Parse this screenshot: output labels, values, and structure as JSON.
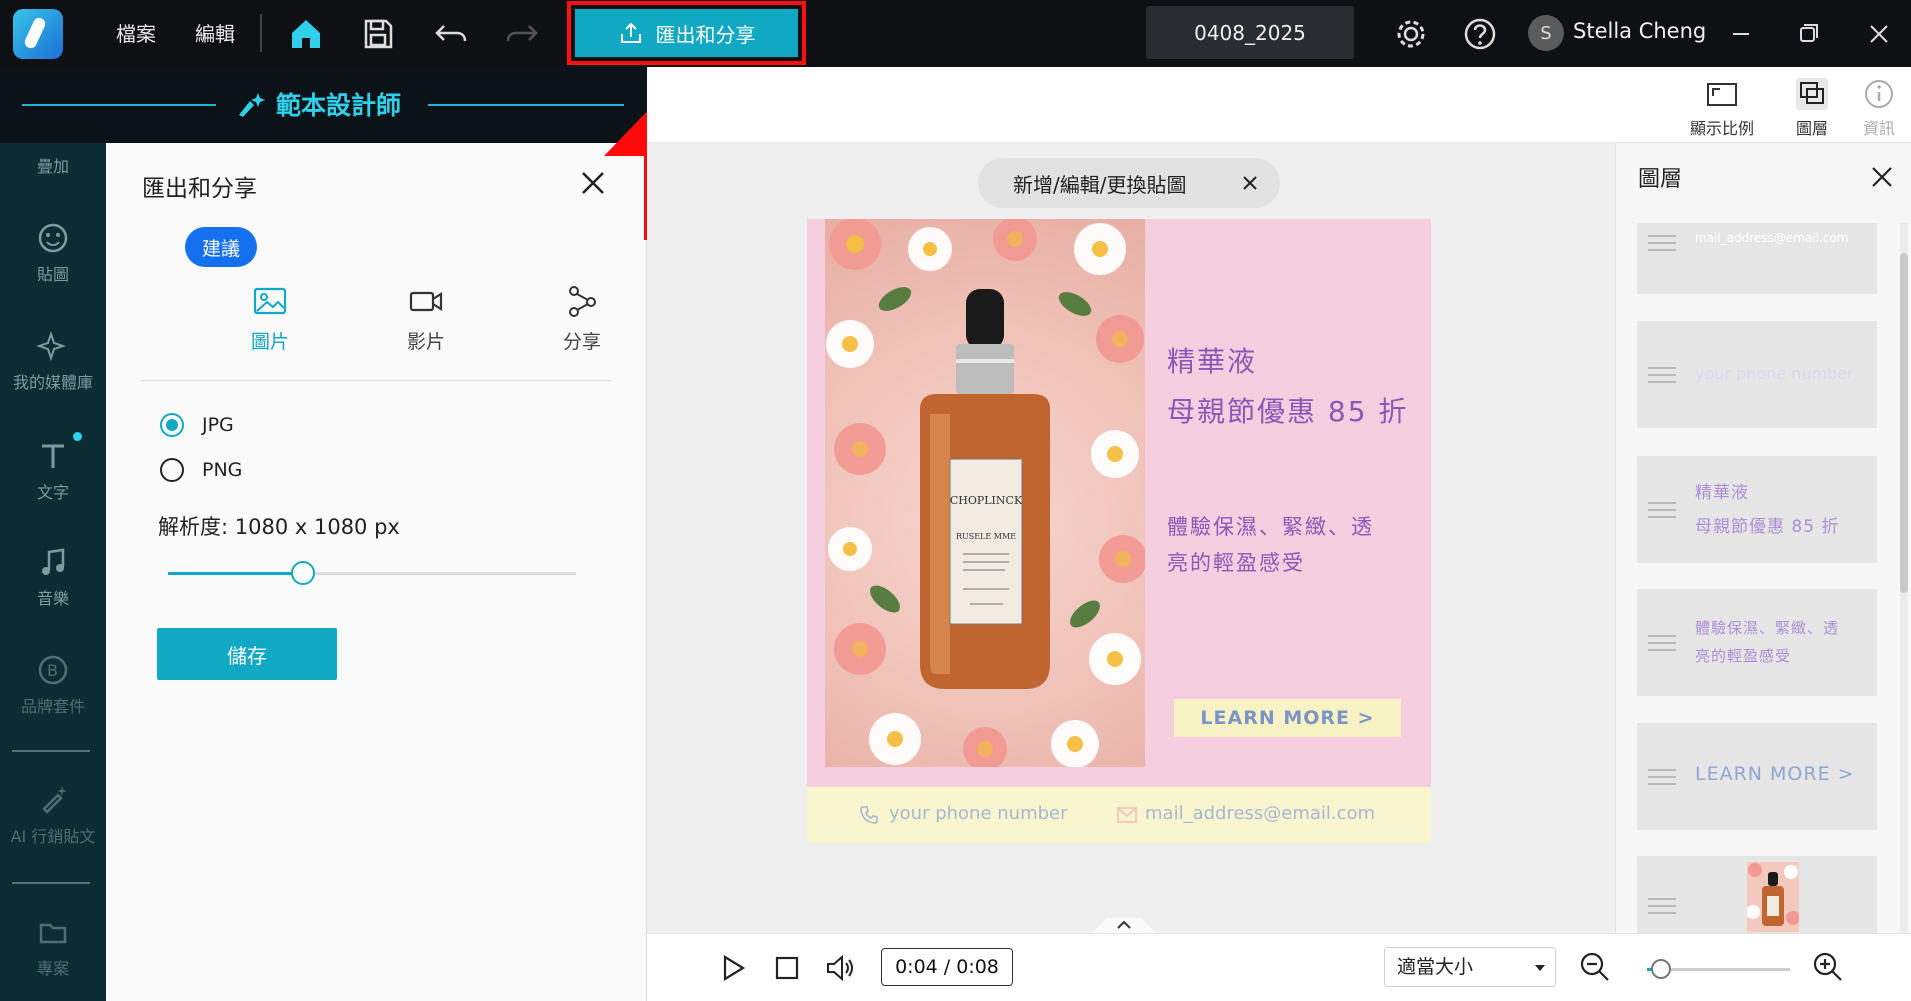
{
  "topbar": {
    "menu": [
      {
        "label": "檔案"
      },
      {
        "label": "編輯"
      }
    ],
    "export_label": "匯出和分享",
    "project_name": "0408_2025",
    "user_initial": "S",
    "user_name": "Stella Cheng"
  },
  "design_header": {
    "title": "範本設計師"
  },
  "sidebar": {
    "items": [
      {
        "label": "疊加"
      },
      {
        "label": "貼圖"
      },
      {
        "label": "我的媒體庫"
      },
      {
        "label": "文字"
      },
      {
        "label": "音樂"
      },
      {
        "label": "品牌套件"
      },
      {
        "label": "AI 行銷貼文"
      },
      {
        "label": "專案"
      }
    ]
  },
  "export_panel": {
    "title": "匯出和分享",
    "badge": "建議",
    "tabs": [
      {
        "label": "圖片",
        "active": true
      },
      {
        "label": "影片",
        "active": false
      },
      {
        "label": "分享",
        "active": false
      }
    ],
    "formats": [
      {
        "label": "JPG",
        "selected": true
      },
      {
        "label": "PNG",
        "selected": false
      }
    ],
    "resolution_label": "解析度: 1080 x 1080 px",
    "resolution_slider_fraction": 0.33,
    "save_label": "儲存"
  },
  "tools": [
    {
      "label": "顯示比例"
    },
    {
      "label": "圖層"
    },
    {
      "label": "資訊"
    }
  ],
  "canvas": {
    "sticker_pill": "新增/編輯/更換貼圖",
    "poster": {
      "headline_1": "精華液",
      "headline_2": "母親節優惠 85 折",
      "body_1": "體驗保濕、緊緻、透",
      "body_2": "亮的輕盈感受",
      "cta": "LEARN MORE  >",
      "phone": "your phone number",
      "email": "mail_address@email.com",
      "bottle_brand": "CHOPLINCK",
      "bottle_sub": "RUSELE MME"
    }
  },
  "layers_panel": {
    "title": "圖層",
    "layers": [
      {
        "text": "mail_address@email.com"
      },
      {
        "text": "your phone number"
      },
      {
        "text_1": "精華液",
        "text_2": "母親節優惠 85 折"
      },
      {
        "text_1": "體驗保濕、緊緻、透",
        "text_2": "亮的輕盈感受"
      },
      {
        "text": "LEARN MORE  >"
      },
      {
        "text": ""
      }
    ]
  },
  "playback": {
    "time": "0:04 / 0:08",
    "zoom_option": "適當大小",
    "zoom_slider_fraction": 0.1
  },
  "colors": {
    "accent": "#10a8c2",
    "highlight": "#ff1010",
    "poster_bg": "#f5cfe0",
    "poster_text": "#8a58b6"
  }
}
